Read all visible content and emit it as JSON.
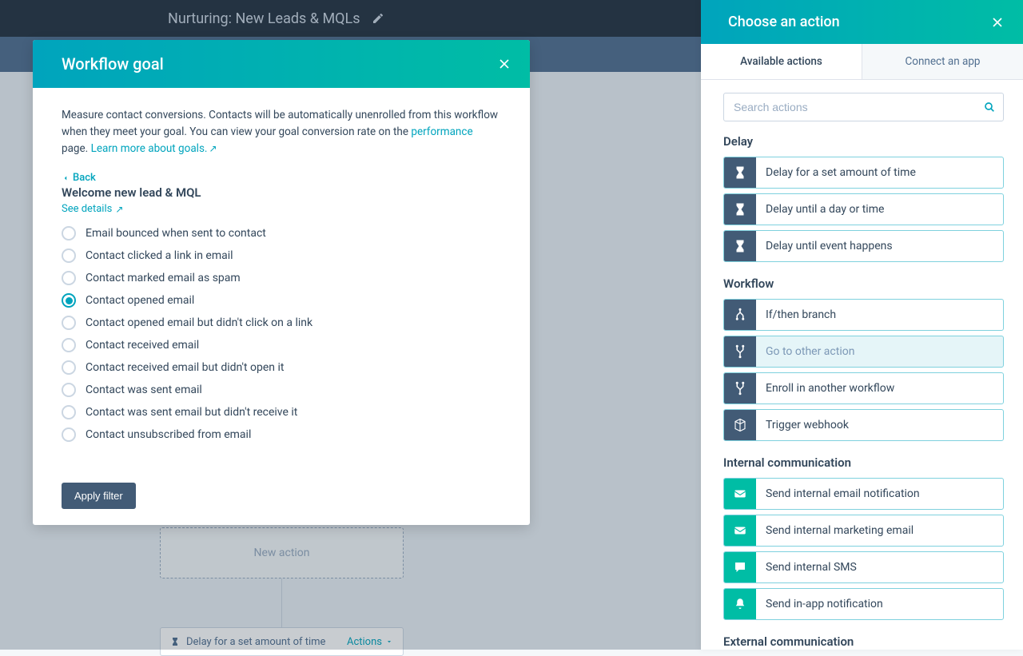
{
  "topbar": {
    "title": "Nurturing: New Leads & MQLs"
  },
  "canvas": {
    "new_action": "New action",
    "delay_label": "Delay for a set amount of time",
    "actions_label": "Actions"
  },
  "modal": {
    "title": "Workflow goal",
    "desc_part1": "Measure contact conversions. Contacts will be automatically unenrolled from this workflow when they meet your goal. You can view your goal conversion rate on the ",
    "perf_link": "performance",
    "desc_part2": " page. ",
    "learn_link": "Learn more about goals.",
    "back": "Back",
    "subheading": "Welcome new lead & MQL",
    "see_details": "See details",
    "options": [
      {
        "label": "Email bounced when sent to contact",
        "selected": false
      },
      {
        "label": "Contact clicked a link in email",
        "selected": false
      },
      {
        "label": "Contact marked email as spam",
        "selected": false
      },
      {
        "label": "Contact opened email",
        "selected": true
      },
      {
        "label": "Contact opened email but didn't click on a link",
        "selected": false
      },
      {
        "label": "Contact received email",
        "selected": false
      },
      {
        "label": "Contact received email but didn't open it",
        "selected": false
      },
      {
        "label": "Contact was sent email",
        "selected": false
      },
      {
        "label": "Contact was sent email but didn't receive it",
        "selected": false
      },
      {
        "label": "Contact unsubscribed from email",
        "selected": false
      }
    ],
    "apply": "Apply filter"
  },
  "panel": {
    "title": "Choose an action",
    "tabs": {
      "available": "Available actions",
      "connect": "Connect an app"
    },
    "search_placeholder": "Search actions",
    "groups": [
      {
        "label": "Delay",
        "icon_color": "navy",
        "items": [
          {
            "label": "Delay for a set amount of time",
            "icon": "hourglass"
          },
          {
            "label": "Delay until a day or time",
            "icon": "hourglass"
          },
          {
            "label": "Delay until event happens",
            "icon": "hourglass"
          }
        ]
      },
      {
        "label": "Workflow",
        "icon_color": "navy",
        "items": [
          {
            "label": "If/then branch",
            "icon": "branch"
          },
          {
            "label": "Go to other action",
            "icon": "merge",
            "hovered": true
          },
          {
            "label": "Enroll in another workflow",
            "icon": "merge"
          },
          {
            "label": "Trigger webhook",
            "icon": "cube"
          }
        ]
      },
      {
        "label": "Internal communication",
        "icon_color": "teal",
        "items": [
          {
            "label": "Send internal email notification",
            "icon": "mail"
          },
          {
            "label": "Send internal marketing email",
            "icon": "mail"
          },
          {
            "label": "Send internal SMS",
            "icon": "chat"
          },
          {
            "label": "Send in-app notification",
            "icon": "bell"
          }
        ]
      },
      {
        "label": "External communication",
        "icon_color": "teal",
        "items": []
      }
    ]
  }
}
